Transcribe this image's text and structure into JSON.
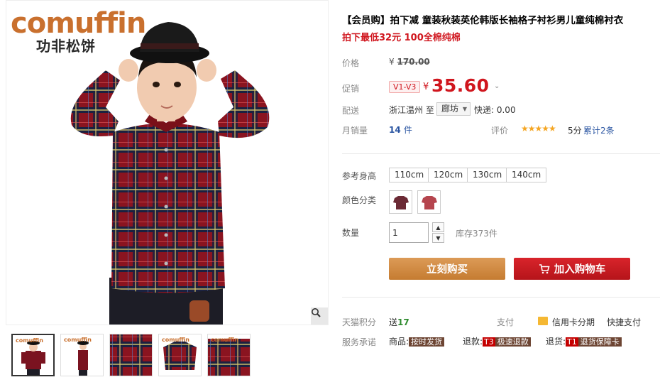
{
  "gallery": {
    "brand_name": "comuffin",
    "brand_cn": "功非松饼",
    "thumbnails": [
      "thumb-1",
      "thumb-2",
      "thumb-3",
      "thumb-4",
      "thumb-5"
    ],
    "selected_index": 0,
    "thumb_logo": "comuffin"
  },
  "product": {
    "title": "【会员购】拍下减 童装秋装英伦韩版长袖格子衬衫男儿童纯棉衬衣",
    "subtitle": "拍下最低32元 100全棉纯棉",
    "price_label": "价格",
    "currency": "¥",
    "original_price": "170.00",
    "promo_label": "促销",
    "promo_badge": "V1-V3",
    "promo_price": "35.60",
    "shipping_label": "配送",
    "ship_from": "浙江温州 至",
    "ship_to": "廊坊",
    "ship_fee": "快递: 0.00",
    "sales_label": "月销量",
    "sales_count": "14",
    "sales_unit": "件",
    "rating_label": "评价",
    "stars": "★★★★★",
    "score": "5分",
    "reviews": "累计2条"
  },
  "options": {
    "size_label": "参考身高",
    "sizes": [
      "110cm",
      "120cm",
      "130cm",
      "140cm"
    ],
    "color_label": "颜色分类",
    "colors": [
      "#6b2a35",
      "#b5454e"
    ],
    "qty_label": "数量",
    "qty_value": "1",
    "stock": "库存373件"
  },
  "actions": {
    "buy_now": "立刻购买",
    "add_to_cart": "加入购物车"
  },
  "footer": {
    "points_label": "天猫积分",
    "points_prefix": "送",
    "points_value": "17",
    "pay_label": "支付",
    "credit_card": "信用卡分期",
    "quick_pay": "快捷支付",
    "service_label": "服务承诺",
    "goods_label": "商品:",
    "goods_tag": "按时发货",
    "refund_label": "退款:",
    "refund_code": "T3",
    "refund_tag": "极速退款",
    "return_label": "退货:",
    "return_code": "T1",
    "return_tag": "退货保障卡"
  },
  "colors": {
    "accent_red": "#d0161e",
    "buy_orange": "#c57c31",
    "cart_red": "#c40000",
    "link_blue": "#2954a1"
  }
}
